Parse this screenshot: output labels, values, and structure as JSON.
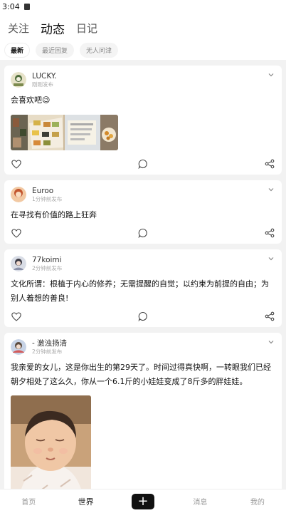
{
  "status_bar": {
    "time": "3:04"
  },
  "top_tabs": [
    "关注",
    "动态",
    "日记"
  ],
  "active_top_tab": 1,
  "filters": [
    "最新",
    "最近回复",
    "无人问津"
  ],
  "active_filter": 0,
  "posts": [
    {
      "user": "LUCKY.",
      "time": "刚刚发布",
      "text": "会喜欢吧😉",
      "has_images": true
    },
    {
      "user": "Euroo",
      "time": "1分钟前发布",
      "text": "在寻找有价值的路上狂奔"
    },
    {
      "user": "77koimi",
      "time": "2分钟前发布",
      "text": "文化所谓：根植于内心的修养；无需提醒的自觉；以约束为前提的自由；为别人着想的善良!"
    },
    {
      "user": "- 激浊扬清",
      "time": "2分钟前发布",
      "text": "我亲爱的女儿，这是你出生的第29天了。时间过得真快啊，一转眼我们已经朝夕相处了这么久，你从一个6.1斤的小娃娃变成了8斤多的胖娃娃。",
      "has_photo": true
    }
  ],
  "bottom_nav": {
    "home": "首页",
    "world": "世界",
    "plus": "+",
    "messages": "消息",
    "mine": "我的"
  },
  "colors": {
    "accent": "#111111",
    "muted": "#999999",
    "background": "#f2f2f2"
  },
  "icons": [
    "heart-icon",
    "comment-icon",
    "share-icon",
    "chevron-down-icon",
    "plus-icon"
  ]
}
